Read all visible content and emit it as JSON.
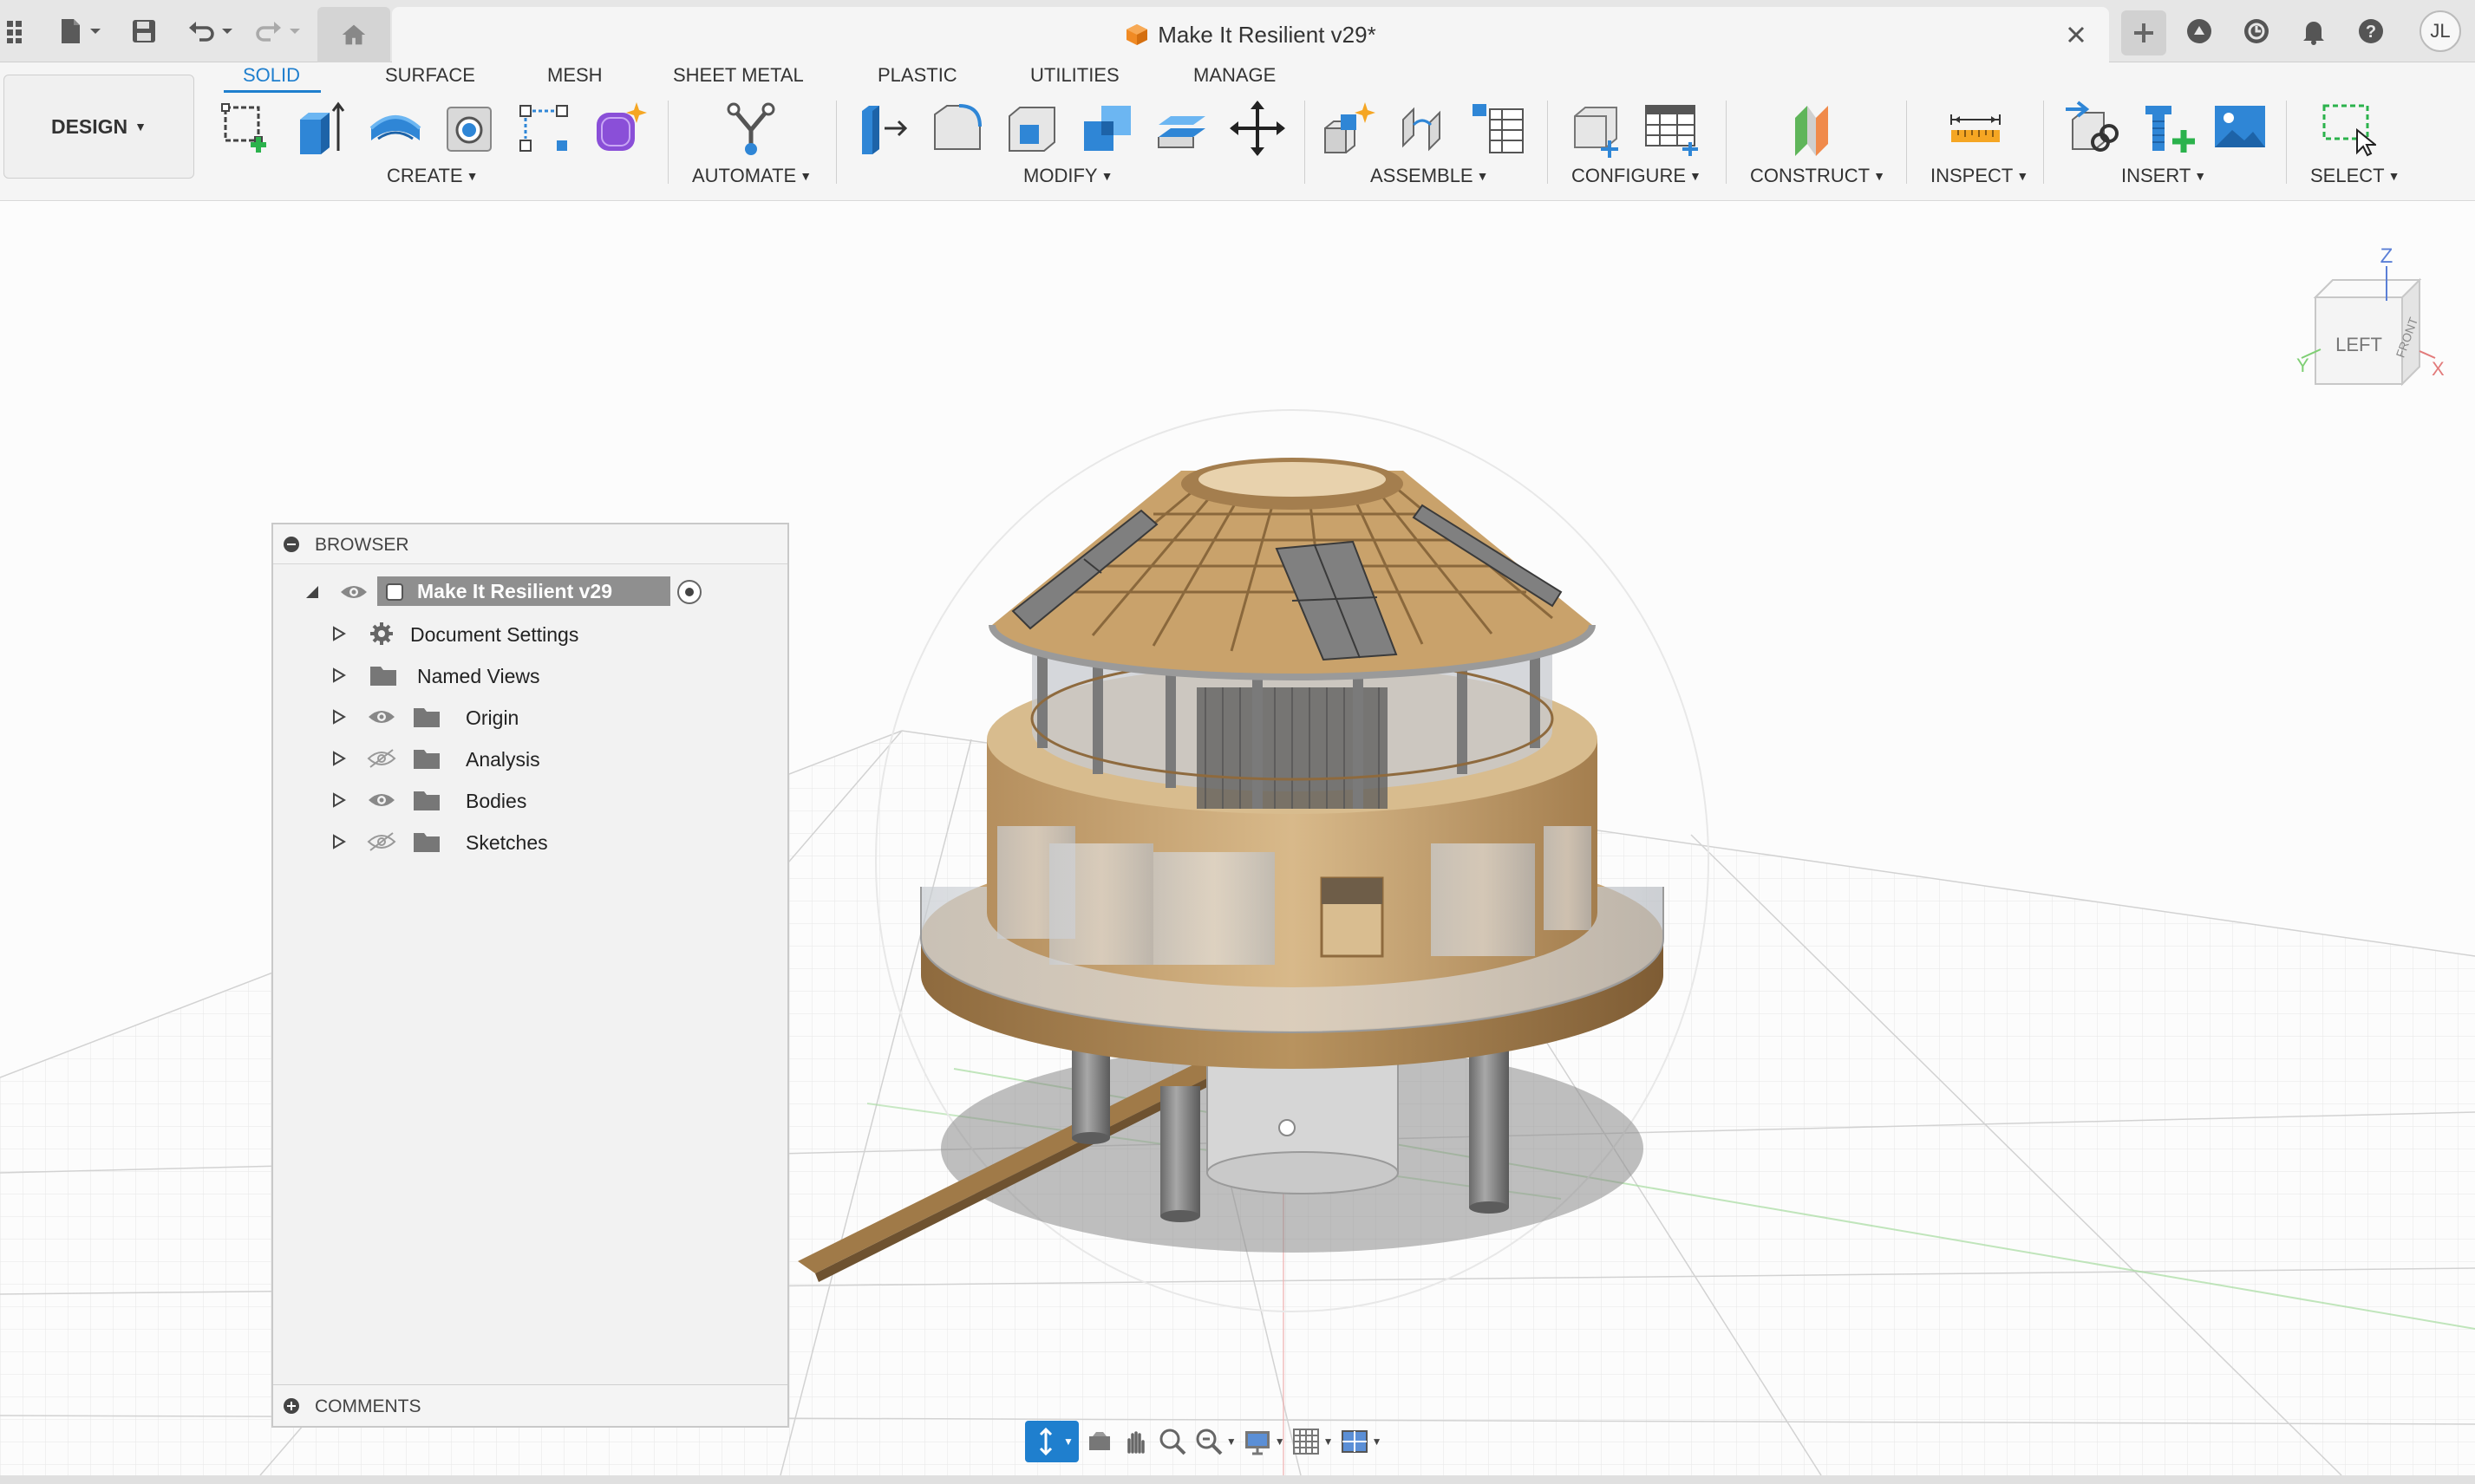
{
  "window": {
    "document_title": "Make It Resilient v29*"
  },
  "user": {
    "initials": "JL"
  },
  "workspace": {
    "label": "DESIGN"
  },
  "ribbon": {
    "tabs": [
      {
        "label": "SOLID",
        "active": true
      },
      {
        "label": "SURFACE"
      },
      {
        "label": "MESH"
      },
      {
        "label": "SHEET METAL"
      },
      {
        "label": "PLASTIC"
      },
      {
        "label": "UTILITIES"
      },
      {
        "label": "MANAGE"
      }
    ],
    "groups": {
      "create": "CREATE",
      "automate": "AUTOMATE",
      "modify": "MODIFY",
      "assemble": "ASSEMBLE",
      "configure": "CONFIGURE",
      "construct": "CONSTRUCT",
      "inspect": "INSPECT",
      "insert": "INSERT",
      "select": "SELECT"
    },
    "accent_color": "#1f7fce"
  },
  "browser": {
    "title": "BROWSER",
    "root": "Make It Resilient v29",
    "items": [
      {
        "label": "Document Settings",
        "icon": "gear-icon",
        "visibility": "none"
      },
      {
        "label": "Named Views",
        "icon": "folder-icon",
        "visibility": "none"
      },
      {
        "label": "Origin",
        "icon": "folder-icon",
        "visibility": "visible"
      },
      {
        "label": "Analysis",
        "icon": "folder-icon",
        "visibility": "hidden"
      },
      {
        "label": "Bodies",
        "icon": "folder-icon",
        "visibility": "visible"
      },
      {
        "label": "Sketches",
        "icon": "folder-icon",
        "visibility": "hidden"
      }
    ],
    "comments_label": "COMMENTS"
  },
  "viewcube": {
    "top_axis": "Z",
    "left_face": "LEFT",
    "right_face": "FRONT",
    "y_axis": "Y",
    "x_axis": "X"
  }
}
